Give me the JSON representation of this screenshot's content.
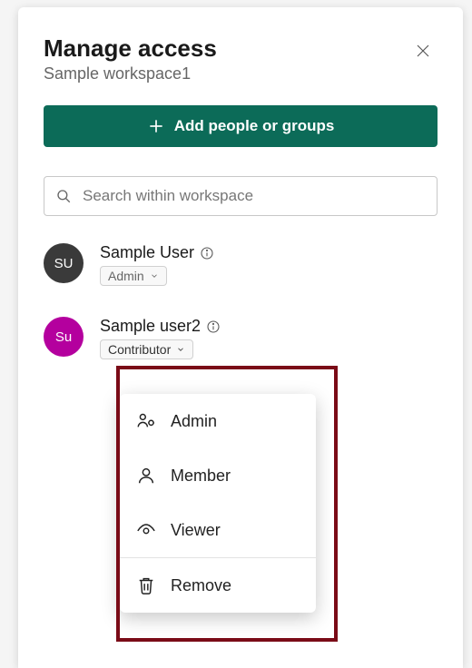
{
  "dialog": {
    "title": "Manage access",
    "subtitle": "Sample workspace1"
  },
  "actions": {
    "add_label": "Add people or groups"
  },
  "search": {
    "placeholder": "Search within workspace"
  },
  "members": [
    {
      "initials": "SU",
      "name": "Sample User",
      "role": "Admin",
      "avatar_color": "grey",
      "role_locked": true
    },
    {
      "initials": "Su",
      "name": "Sample user2",
      "role": "Contributor",
      "avatar_color": "magenta",
      "role_locked": false
    }
  ],
  "role_menu": {
    "options": [
      {
        "id": "admin",
        "label": "Admin"
      },
      {
        "id": "member",
        "label": "Member"
      },
      {
        "id": "viewer",
        "label": "Viewer"
      }
    ],
    "remove_label": "Remove"
  }
}
